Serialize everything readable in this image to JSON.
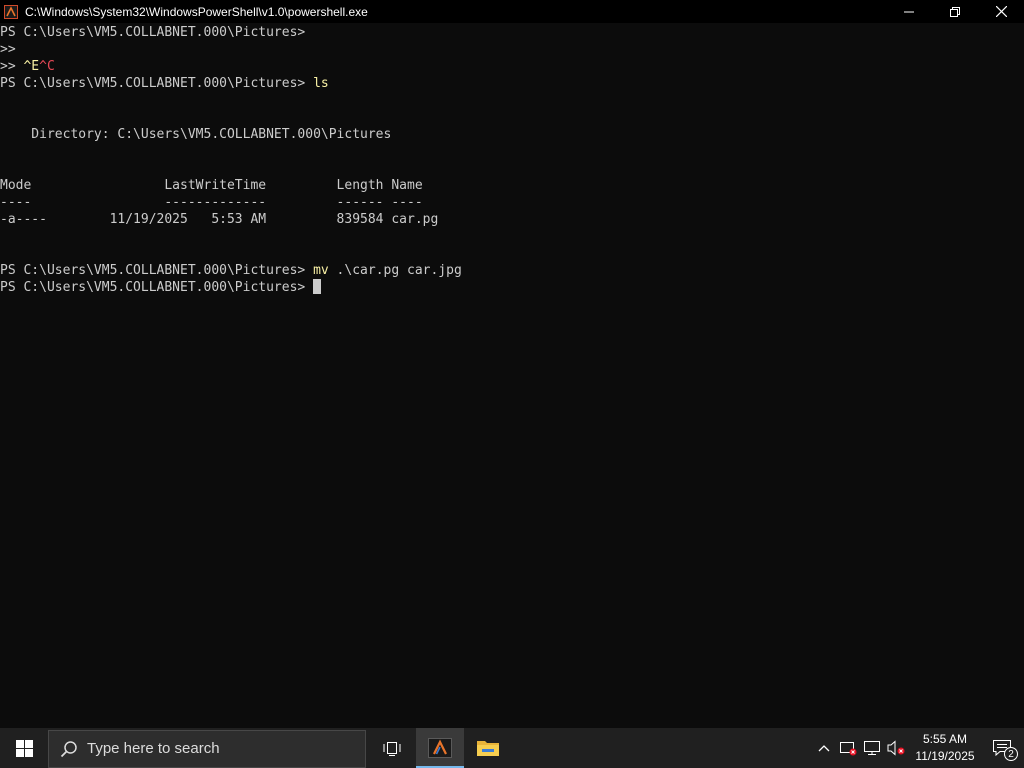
{
  "window": {
    "title": "C:\\Windows\\System32\\WindowsPowerShell\\v1.0\\powershell.exe",
    "icon": "powershell-app-icon",
    "controls": [
      "minimize-icon",
      "restore-icon",
      "close-icon"
    ]
  },
  "console": {
    "lines": [
      {
        "prompt": "PS C:\\Users\\VM5.COLLABNET.000\\Pictures> ",
        "cmd": ""
      },
      {
        "prompt": ">> ",
        "cmd": ""
      },
      {
        "prompt": ">> ",
        "ctrl_a": "^E",
        "ctrl_b": "^C"
      },
      {
        "prompt": "PS C:\\Users\\VM5.COLLABNET.000\\Pictures> ",
        "cmd": "ls"
      },
      {
        "text": "    Directory: C:\\Users\\VM5.COLLABNET.000\\Pictures"
      },
      {
        "text": "Mode                 LastWriteTime         Length Name"
      },
      {
        "text": "----                 -------------         ------ ----"
      },
      {
        "text": "-a----        11/19/2025   5:53 AM         839584 car.pg"
      },
      {
        "prompt": "PS C:\\Users\\VM5.COLLABNET.000\\Pictures> ",
        "cmd": "mv",
        "args": " .\\car.pg car.jpg"
      },
      {
        "prompt": "PS C:\\Users\\VM5.COLLABNET.000\\Pictures> ",
        "cmd": ""
      }
    ],
    "colors": {
      "background": "#0c0c0c",
      "text": "#cccccc",
      "command": "#f9f1a5",
      "control": "#e74856"
    }
  },
  "taskbar": {
    "start_icon": "windows-logo-icon",
    "search_placeholder": "Type here to search",
    "pinned": [
      "task-view-icon",
      "powershell-taskbar-icon",
      "file-explorer-icon"
    ],
    "tray_icons": [
      "chevron-up-icon",
      "security-icon",
      "network-icon",
      "volume-muted-icon"
    ],
    "clock_time": "5:55 AM",
    "clock_date": "11/19/2025",
    "notification_count": "2"
  }
}
